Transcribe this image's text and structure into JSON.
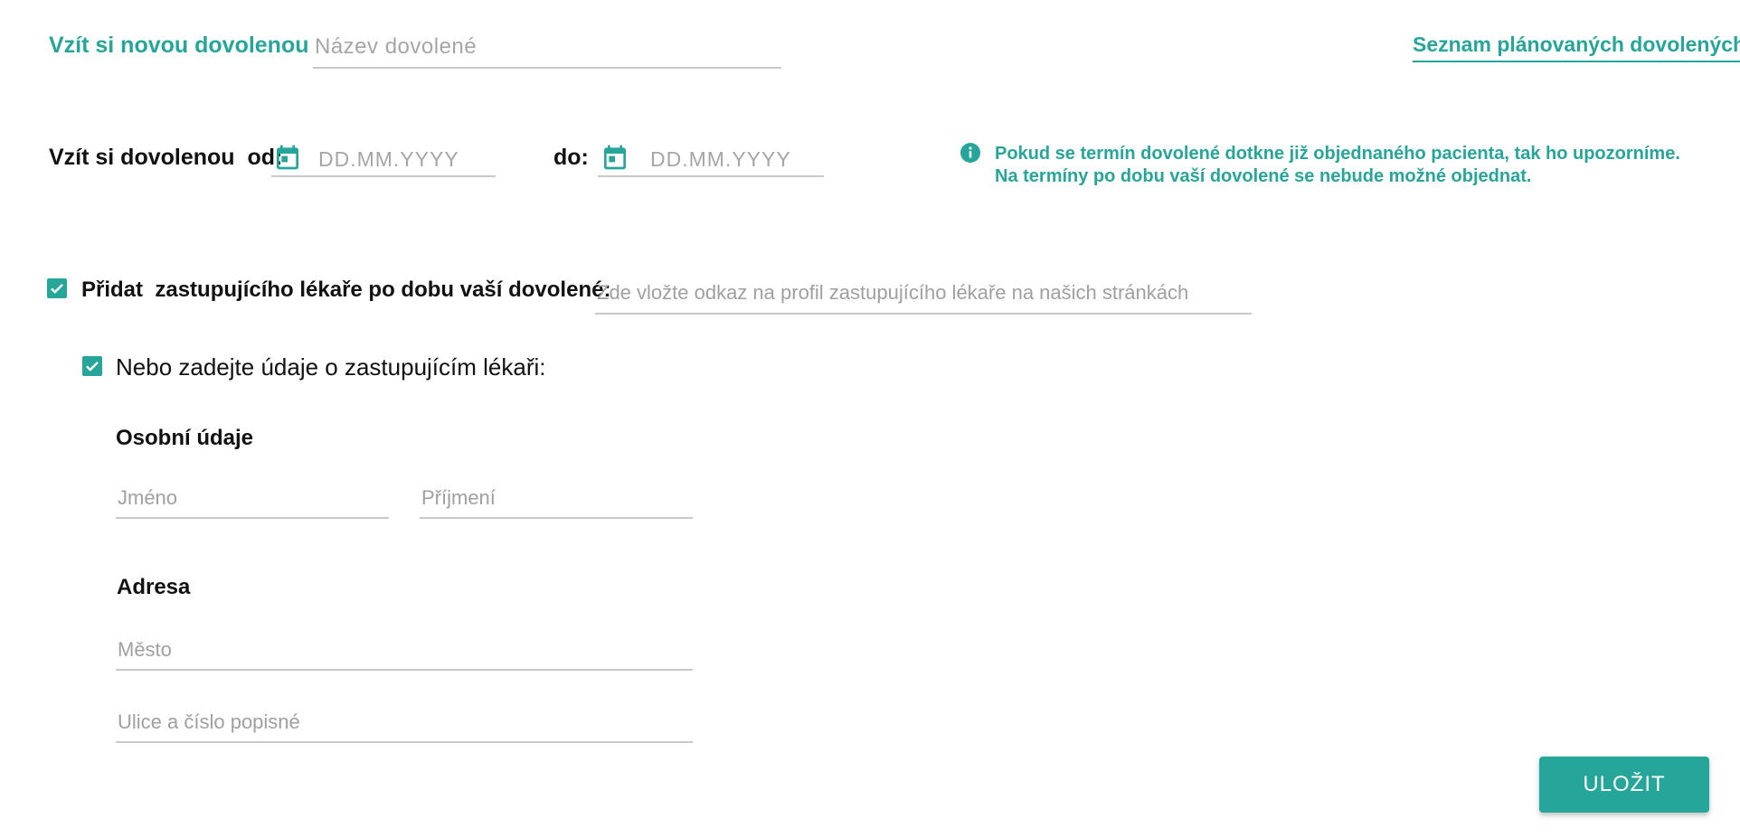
{
  "header": {
    "title": "Vzít si novou dovolenou",
    "name_placeholder": "Název dovolené",
    "planned_link": "Seznam plánovaných dovolených"
  },
  "dates": {
    "label_prefix": "Vzít si dovolenou  od:",
    "to_label": "do:",
    "from_placeholder": "DD.MM.YYYY",
    "to_placeholder": "DD.MM.YYYY"
  },
  "info": {
    "line1": "Pokud se termín dovolené dotkne již objednaného pacienta, tak ho upozorníme.",
    "line2": "Na termíny po dobu vaší dovolené se nebude možné objednat."
  },
  "substitute": {
    "label": "Přidat  zastupujícího lékaře po dobu vaší dovolené:",
    "link_placeholder": "Zde vložte odkaz na profil zastupujícího lékaře na našich stránkách",
    "checked": true
  },
  "manual": {
    "label": "Nebo zadejte údaje o zastupujícím lékaři:",
    "checked": true,
    "personal_heading": "Osobní údaje",
    "first_name_placeholder": "Jméno",
    "last_name_placeholder": "Příjmení",
    "address_heading": "Adresa",
    "city_placeholder": "Město",
    "street_placeholder": "Ulice a číslo popisné"
  },
  "actions": {
    "save_label": "ULOŽIT"
  },
  "colors": {
    "accent": "#26a69a"
  }
}
